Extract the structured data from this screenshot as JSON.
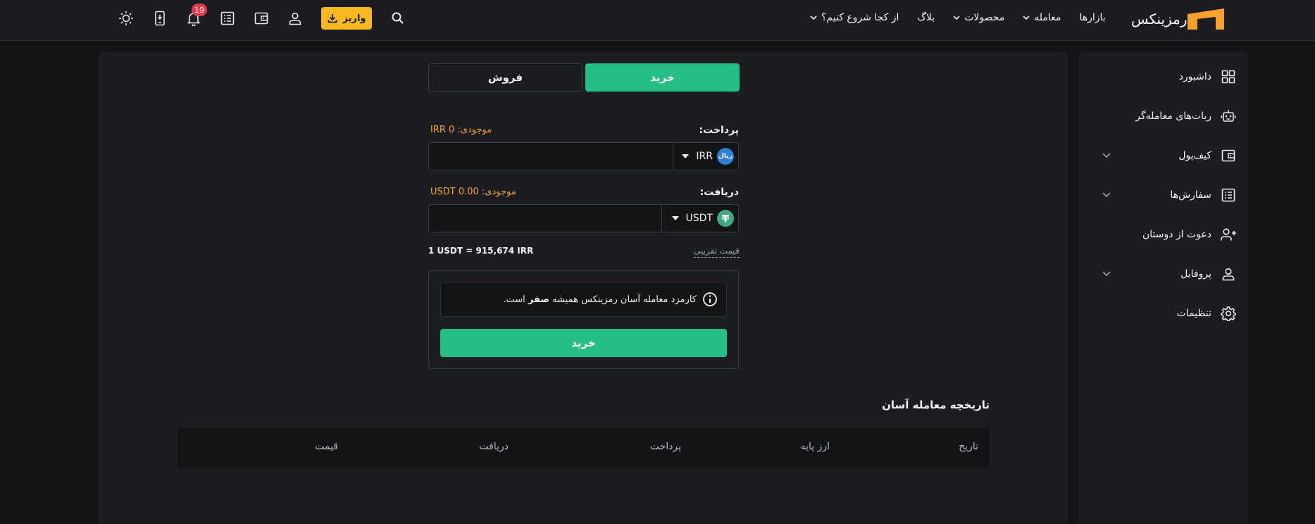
{
  "brand": {
    "name": "رمزینکس",
    "accent": "#f7a02e",
    "green": "#23bf85",
    "yellow": "#f7b91e"
  },
  "nav": {
    "markets": "بازارها",
    "trade": "معامله",
    "products": "محصولات",
    "blog": "بلاگ",
    "start": "از کجا شروع کنیم؟"
  },
  "header": {
    "deposit_label": "واریز",
    "notification_count": "19",
    "icons": [
      "search-icon",
      "user-icon",
      "wallet-icon",
      "orders-icon",
      "bell-icon",
      "mobile-app-icon",
      "theme-sun-icon"
    ]
  },
  "sidebar": {
    "items": [
      {
        "label": "داشبورد",
        "icon": "dashboard-icon"
      },
      {
        "label": "ربات‌های معامله‌گر",
        "icon": "robot-icon"
      },
      {
        "label": "کیف‌پول",
        "icon": "wallet-icon"
      },
      {
        "label": "سفارش‌ها",
        "icon": "orders-icon"
      },
      {
        "label": "دعوت از دوستان",
        "icon": "invite-user-icon"
      },
      {
        "label": "پروفایل",
        "icon": "profile-icon"
      },
      {
        "label": "تنظیمات",
        "icon": "settings-gear-icon"
      }
    ]
  },
  "trade": {
    "tab_buy": "خرید",
    "tab_sell": "فروش",
    "pay_label": "پرداخت:",
    "pay_balance": "موجودی: IRR 0",
    "pay_currency": "IRR",
    "pay_coin_text": "ریال",
    "pay_value": "",
    "receive_label": "دریافت:",
    "receive_balance": "موجودی: USDT 0.00",
    "receive_currency": "USDT",
    "receive_value": "",
    "rate": "1 USDT = 915,674 IRR",
    "approx_label": "قیمت تقریبی",
    "notice_pre": "کارمزد معامله آسان رمزینکس همیشه",
    "notice_bold": "صفر",
    "notice_post": "است.",
    "buy_button": "خرید"
  },
  "history": {
    "title": "تاریخچه معامله آسان",
    "columns": [
      "تاریخ",
      "ارز پایه",
      "پرداخت",
      "دریافت",
      "قیمت"
    ]
  }
}
